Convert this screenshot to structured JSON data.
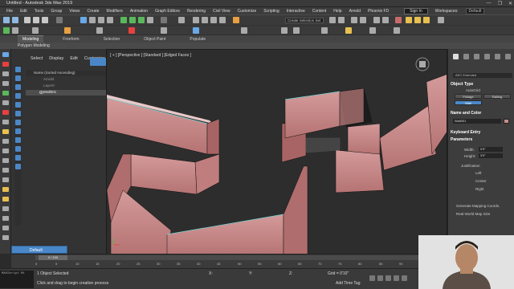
{
  "window": {
    "title": "Untitled - Autodesk 3ds Max 2019",
    "controls": [
      "—",
      "❐",
      "✕"
    ]
  },
  "menubar": {
    "items": [
      "File",
      "Edit",
      "Tools",
      "Group",
      "Views",
      "Create",
      "Modifiers",
      "Animation",
      "Graph Editors",
      "Rendering",
      "Civil View",
      "Customize",
      "Scripting",
      "Interactive",
      "Content",
      "Help",
      "Arnold",
      "Phoenix FD"
    ],
    "signin": "Sign In",
    "workspaces_label": "Workspaces:",
    "workspace_value": "Default"
  },
  "toolbar": {
    "selection_set": "Create Selection Set"
  },
  "ribbon": {
    "tabs": [
      "Modeling",
      "Freeform",
      "Selection",
      "Object Paint",
      "Populate"
    ],
    "active_panel": "Polygon Modeling"
  },
  "scene_explorer": {
    "menu": [
      "Select",
      "Display",
      "Edit",
      "Customize"
    ],
    "header": "Name (Sorted Ascending)",
    "rows": [
      "Arnold",
      "Layer0",
      "Wall001"
    ]
  },
  "viewport": {
    "label": "[ + ] [Perspective ] [Standard ] [Edged Faces ]"
  },
  "command_panel": {
    "category": "AEC Extended",
    "object_type_title": "Object Type",
    "autogrid_label": "AutoGrid",
    "buttons": [
      "Foliage",
      "Railing",
      "Wall"
    ],
    "name_color_title": "Name and Color",
    "name_value": "Wall001",
    "keyboard_entry_title": "Keyboard Entry",
    "parameters_title": "Parameters",
    "width_label": "Width:",
    "width_value": "0'5\"",
    "height_label": "Height:",
    "height_value": "3'0\"",
    "justification_label": "Justification",
    "justification_options": [
      "Left",
      "Center",
      "Right"
    ],
    "gen_mapping": "Generate Mapping Coords.",
    "real_world": "Real-World Map Size",
    "colors": {
      "object_color": "#c98c8c",
      "accent": "#4a87c8"
    }
  },
  "layer": {
    "name": "Default"
  },
  "timeline": {
    "frame_display": "0 / 100",
    "ticks": [
      "0",
      "5",
      "10",
      "15",
      "20",
      "25",
      "30",
      "35",
      "40",
      "45",
      "50",
      "55",
      "60",
      "65",
      "70",
      "75",
      "80",
      "85",
      "90",
      "95",
      "100"
    ]
  },
  "statusbar": {
    "maxscript": "MAXScript Mi",
    "objects_selected": "1 Object Selected",
    "prompt": "Click and drag to begin creation process",
    "x": "X:",
    "y": "Y:",
    "z": "Z:",
    "grid": "Grid = 0'10\"",
    "add_time_tag": "Add Time Tag"
  }
}
